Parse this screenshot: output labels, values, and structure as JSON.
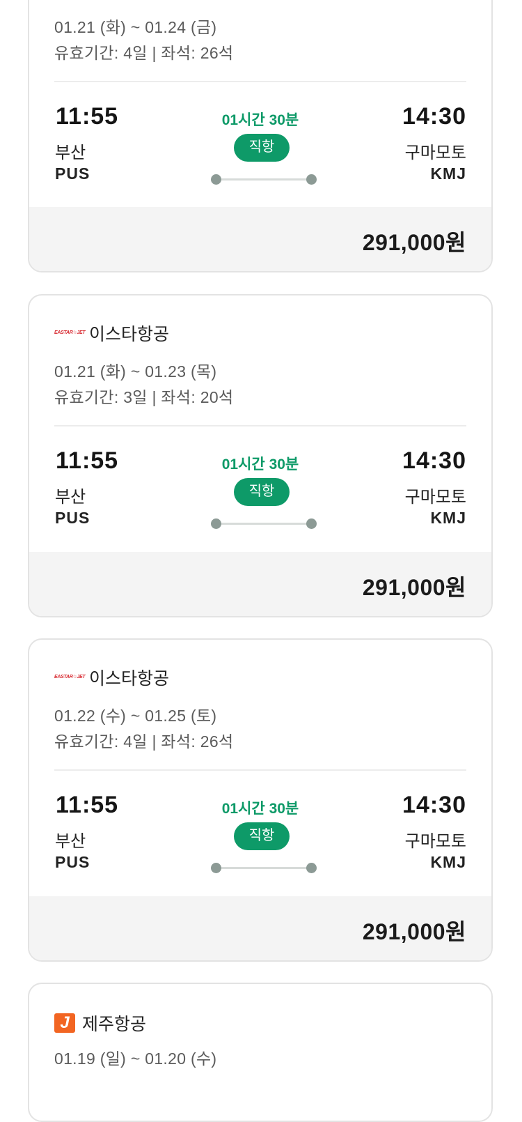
{
  "cards": [
    {
      "dates": "01.21 (화) ~ 01.24 (금)",
      "validity": "유효기간: 4일 | 좌석: 26석",
      "dep_time": "11:55",
      "dep_city": "부산",
      "dep_code": "PUS",
      "arr_time": "14:30",
      "arr_city": "구마모토",
      "arr_code": "KMJ",
      "duration": "01시간 30분",
      "badge": "직항",
      "price": "291,000원"
    },
    {
      "airline": "이스타항공",
      "logo": "EASTAR☆JET",
      "dates": "01.21 (화) ~ 01.23 (목)",
      "validity": "유효기간: 3일 | 좌석: 20석",
      "dep_time": "11:55",
      "dep_city": "부산",
      "dep_code": "PUS",
      "arr_time": "14:30",
      "arr_city": "구마모토",
      "arr_code": "KMJ",
      "duration": "01시간 30분",
      "badge": "직항",
      "price": "291,000원"
    },
    {
      "airline": "이스타항공",
      "logo": "EASTAR☆JET",
      "dates": "01.22 (수) ~ 01.25 (토)",
      "validity": "유효기간: 4일 | 좌석: 26석",
      "dep_time": "11:55",
      "dep_city": "부산",
      "dep_code": "PUS",
      "arr_time": "14:30",
      "arr_city": "구마모토",
      "arr_code": "KMJ",
      "duration": "01시간 30분",
      "badge": "직항",
      "price": "291,000원"
    },
    {
      "airline": "제주항공",
      "logo": "J",
      "dates": "01.19 (일) ~ 01.20 (수)"
    }
  ],
  "colors": {
    "accent": "#0e9a68",
    "eastar": "#d7282f",
    "jeju": "#f26522"
  }
}
